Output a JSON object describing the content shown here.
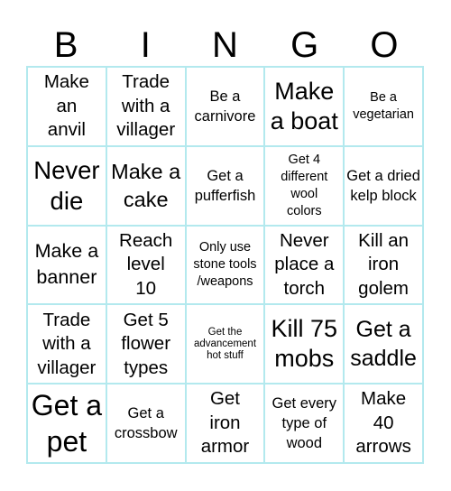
{
  "header": [
    "B",
    "I",
    "N",
    "G",
    "O"
  ],
  "colors": {
    "grid_line": "#b3e9ee",
    "text": "#000000",
    "background": "#ffffff"
  },
  "cells": [
    "Make an anvil",
    "Trade with a villager",
    "Be a carnivore",
    "Make a boat",
    "Be a vegetarian",
    "Never die",
    "Make a cake",
    "Get a pufferfish",
    "Get 4 different wool colors",
    "Get a dried kelp block",
    "Make a banner",
    "Reach level 10",
    "Only use stone tools /weapons",
    "Never place a torch",
    "Kill an iron golem",
    "Trade with a villager",
    "Get 5 flower types",
    "Get the advancement hot stuff",
    "Kill 75 mobs",
    "Get a saddle",
    "Get a pet",
    "Get a crossbow",
    "Get iron armor",
    "Get every type of wood",
    "Make 40 arrows"
  ]
}
